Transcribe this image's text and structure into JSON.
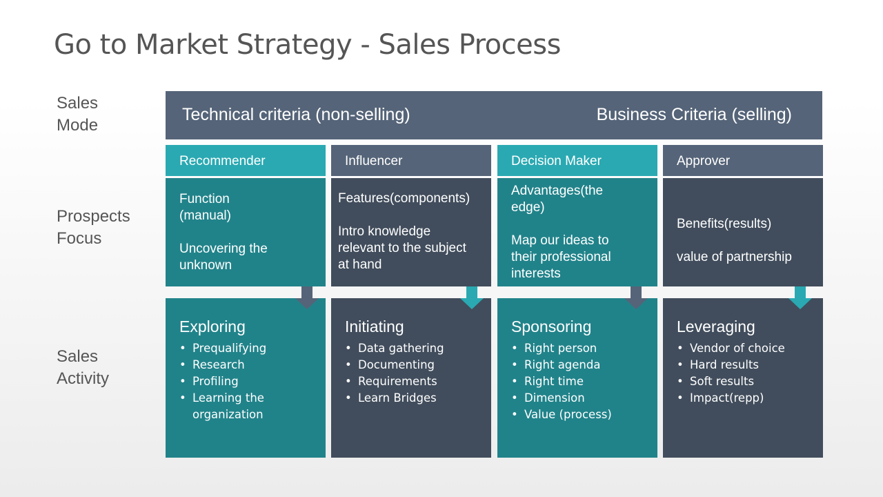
{
  "title": "Go to Market Strategy - Sales Process",
  "row_labels": {
    "sales_mode": "Sales\nMode",
    "prospects_focus": "Prospects\nFocus",
    "sales_activity": " Sales\nActivity"
  },
  "sales_mode": {
    "left": "Technical criteria (non-selling)",
    "right": "Business Criteria (selling)"
  },
  "colors": {
    "teal_light": "#2aa9b2",
    "teal_dark": "#21838a",
    "slate": "#556478",
    "slate_dark": "#414d5c"
  },
  "columns": [
    {
      "role": "Recommender",
      "focus": [
        "Function\n(manual)",
        "Uncovering the\nunknown"
      ],
      "activity_title": "Exploring",
      "activities": [
        "Prequalifying",
        "Research",
        "Profiling",
        "Learning the organization"
      ],
      "arrow_icon": "down-arrow-icon"
    },
    {
      "role": "Influencer",
      "focus": [
        "Features(components)",
        "Intro knowledge\nrelevant to the subject\nat hand"
      ],
      "activity_title": "Initiating",
      "activities": [
        "Data gathering",
        "Documenting",
        "Requirements",
        "Learn Bridges"
      ],
      "arrow_icon": "down-arrow-icon"
    },
    {
      "role": "Decision Maker",
      "focus": [
        "Advantages(the\nedge)",
        "Map our ideas to\ntheir professional\ninterests"
      ],
      "activity_title": "Sponsoring",
      "activities": [
        "Right person",
        "Right agenda",
        "Right time",
        "Dimension",
        "Value (process)"
      ],
      "arrow_icon": "down-arrow-icon"
    },
    {
      "role": "Approver",
      "focus": [
        "Benefits(results)",
        "value of partnership"
      ],
      "activity_title": "Leveraging",
      "activities": [
        "Vendor of choice",
        "Hard results",
        "Soft results",
        "Impact(repp)"
      ],
      "arrow_icon": "down-arrow-icon"
    }
  ]
}
